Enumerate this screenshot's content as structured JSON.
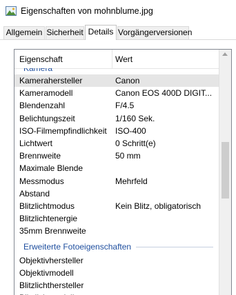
{
  "window": {
    "title": "Eigenschaften von mohnblume.jpg",
    "icon": "image-file-icon"
  },
  "tabs": [
    {
      "label": "Allgemein",
      "active": false
    },
    {
      "label": "Sicherheit",
      "active": false
    },
    {
      "label": "Details",
      "active": true
    },
    {
      "label": "Vorgängerversionen",
      "active": false
    }
  ],
  "list": {
    "columns": {
      "name": "Eigenschaft",
      "value": "Wert"
    },
    "groups": [
      {
        "label": "Kamera",
        "rows": [
          {
            "name": "Kamerahersteller",
            "value": "Canon",
            "selected": true
          },
          {
            "name": "Kameramodell",
            "value": "Canon EOS 400D DIGIT..."
          },
          {
            "name": "Blendenzahl",
            "value": "F/4.5"
          },
          {
            "name": "Belichtungszeit",
            "value": "1/160 Sek."
          },
          {
            "name": "ISO-Filmempfindlichkeit",
            "value": "ISO-400"
          },
          {
            "name": "Lichtwert",
            "value": "0 Schritt(e)"
          },
          {
            "name": "Brennweite",
            "value": "50 mm"
          },
          {
            "name": "Maximale Blende",
            "value": ""
          },
          {
            "name": "Messmodus",
            "value": "Mehrfeld"
          },
          {
            "name": "Abstand",
            "value": ""
          },
          {
            "name": "Blitzlichtmodus",
            "value": "Kein Blitz, obligatorisch"
          },
          {
            "name": "Blitzlichtenergie",
            "value": ""
          },
          {
            "name": "35mm Brennweite",
            "value": ""
          }
        ]
      },
      {
        "label": "Erweiterte Fotoeigenschaften",
        "rows": [
          {
            "name": "Objektivhersteller",
            "value": ""
          },
          {
            "name": "Objektivmodell",
            "value": ""
          },
          {
            "name": "Blitzlichthersteller",
            "value": ""
          },
          {
            "name": "Blitzlichtmodell",
            "value": ""
          }
        ]
      }
    ]
  },
  "scrollbar": {
    "position": 0.45
  }
}
